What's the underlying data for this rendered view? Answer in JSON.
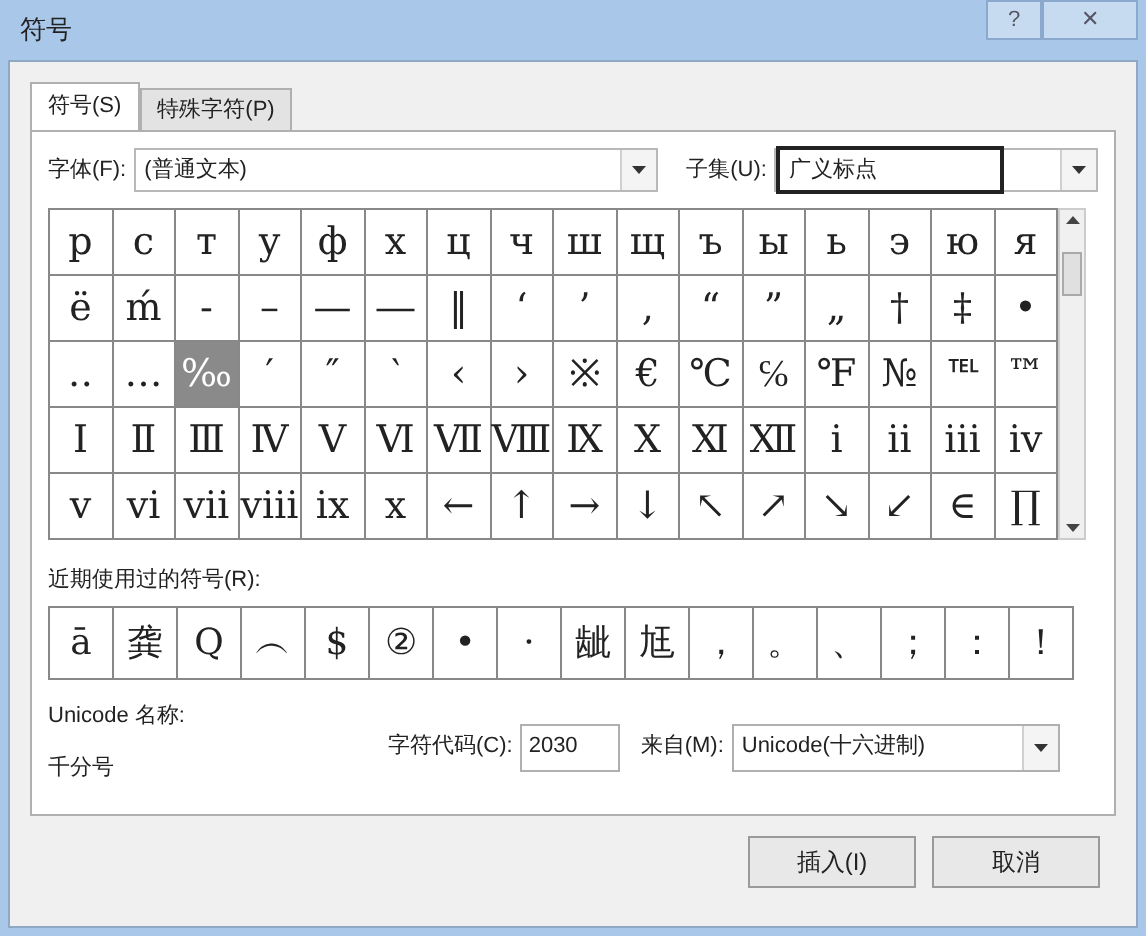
{
  "window": {
    "title": "符号",
    "buttons": [
      {
        "kind": "help",
        "label": "?"
      },
      {
        "kind": "close",
        "label": "✕"
      }
    ]
  },
  "tabs": [
    {
      "label": "符号(S)",
      "selected": true
    },
    {
      "label": "特殊字符(P)",
      "selected": false
    }
  ],
  "font": {
    "label": "字体(F):",
    "value": "(普通文本)"
  },
  "subset": {
    "label": "子集(U):",
    "value": "广义标点"
  },
  "grid": {
    "cells": [
      {
        "symbol": "р",
        "selected": false
      },
      {
        "symbol": "с",
        "selected": false
      },
      {
        "symbol": "т",
        "selected": false
      },
      {
        "symbol": "у",
        "selected": false
      },
      {
        "symbol": "ф",
        "selected": false
      },
      {
        "symbol": "х",
        "selected": false
      },
      {
        "symbol": "ц",
        "selected": false
      },
      {
        "symbol": "ч",
        "selected": false
      },
      {
        "symbol": "ш",
        "selected": false
      },
      {
        "symbol": "щ",
        "selected": false
      },
      {
        "symbol": "ъ",
        "selected": false
      },
      {
        "symbol": "ы",
        "selected": false
      },
      {
        "symbol": "ь",
        "selected": false
      },
      {
        "symbol": "э",
        "selected": false
      },
      {
        "symbol": "ю",
        "selected": false
      },
      {
        "symbol": "я",
        "selected": false
      },
      {
        "symbol": "ё",
        "selected": false
      },
      {
        "symbol": "ḿ",
        "selected": false
      },
      {
        "symbol": "‐",
        "selected": false
      },
      {
        "symbol": "–",
        "selected": false
      },
      {
        "symbol": "—",
        "selected": false
      },
      {
        "symbol": "―",
        "selected": false
      },
      {
        "symbol": "‖",
        "selected": false
      },
      {
        "symbol": "‘",
        "selected": false
      },
      {
        "symbol": "’",
        "selected": false
      },
      {
        "symbol": "‚",
        "selected": false
      },
      {
        "symbol": "“",
        "selected": false
      },
      {
        "symbol": "”",
        "selected": false
      },
      {
        "symbol": "„",
        "selected": false
      },
      {
        "symbol": "†",
        "selected": false
      },
      {
        "symbol": "‡",
        "selected": false
      },
      {
        "symbol": "•",
        "selected": false
      },
      {
        "symbol": "‥",
        "selected": false
      },
      {
        "symbol": "…",
        "selected": false
      },
      {
        "symbol": "‰",
        "selected": true
      },
      {
        "symbol": "′",
        "selected": false
      },
      {
        "symbol": "″",
        "selected": false
      },
      {
        "symbol": "‵",
        "selected": false
      },
      {
        "symbol": "‹",
        "selected": false
      },
      {
        "symbol": "›",
        "selected": false
      },
      {
        "symbol": "※",
        "selected": false
      },
      {
        "symbol": "€",
        "selected": false
      },
      {
        "symbol": "℃",
        "selected": false
      },
      {
        "symbol": "℅",
        "selected": false
      },
      {
        "symbol": "℉",
        "selected": false
      },
      {
        "symbol": "№",
        "selected": false
      },
      {
        "symbol": "℡",
        "selected": false
      },
      {
        "symbol": "™",
        "selected": false
      },
      {
        "symbol": "Ⅰ",
        "selected": false
      },
      {
        "symbol": "Ⅱ",
        "selected": false
      },
      {
        "symbol": "Ⅲ",
        "selected": false
      },
      {
        "symbol": "Ⅳ",
        "selected": false
      },
      {
        "symbol": "Ⅴ",
        "selected": false
      },
      {
        "symbol": "Ⅵ",
        "selected": false
      },
      {
        "symbol": "Ⅶ",
        "selected": false
      },
      {
        "symbol": "Ⅷ",
        "selected": false
      },
      {
        "symbol": "Ⅸ",
        "selected": false
      },
      {
        "symbol": "Ⅹ",
        "selected": false
      },
      {
        "symbol": "Ⅺ",
        "selected": false
      },
      {
        "symbol": "Ⅻ",
        "selected": false
      },
      {
        "symbol": "ⅰ",
        "selected": false
      },
      {
        "symbol": "ⅱ",
        "selected": false
      },
      {
        "symbol": "ⅲ",
        "selected": false
      },
      {
        "symbol": "ⅳ",
        "selected": false
      },
      {
        "symbol": "ⅴ",
        "selected": false
      },
      {
        "symbol": "ⅵ",
        "selected": false
      },
      {
        "symbol": "ⅶ",
        "selected": false
      },
      {
        "symbol": "ⅷ",
        "selected": false
      },
      {
        "symbol": "ⅸ",
        "selected": false
      },
      {
        "symbol": "ⅹ",
        "selected": false
      },
      {
        "symbol": "←",
        "selected": false
      },
      {
        "symbol": "↑",
        "selected": false
      },
      {
        "symbol": "→",
        "selected": false
      },
      {
        "symbol": "↓",
        "selected": false
      },
      {
        "symbol": "↖",
        "selected": false
      },
      {
        "symbol": "↗",
        "selected": false
      },
      {
        "symbol": "↘",
        "selected": false
      },
      {
        "symbol": "↙",
        "selected": false
      },
      {
        "symbol": "∈",
        "selected": false
      },
      {
        "symbol": "∏",
        "selected": false
      }
    ]
  },
  "recent": {
    "label": "近期使用过的符号(R):",
    "symbols": [
      "ā",
      "龚",
      "Q",
      "︵",
      "$",
      "②",
      "•",
      "·",
      "龇",
      "尪",
      "，",
      "。",
      "、",
      "；",
      "：",
      "！"
    ]
  },
  "unicode_name": {
    "label": "Unicode 名称:",
    "value": "千分号"
  },
  "char_code": {
    "label": "字符代码(C):",
    "value": "2030"
  },
  "from": {
    "label": "来自(M):",
    "value": "Unicode(十六进制)"
  },
  "buttons": [
    "插入(I)",
    "取消"
  ]
}
